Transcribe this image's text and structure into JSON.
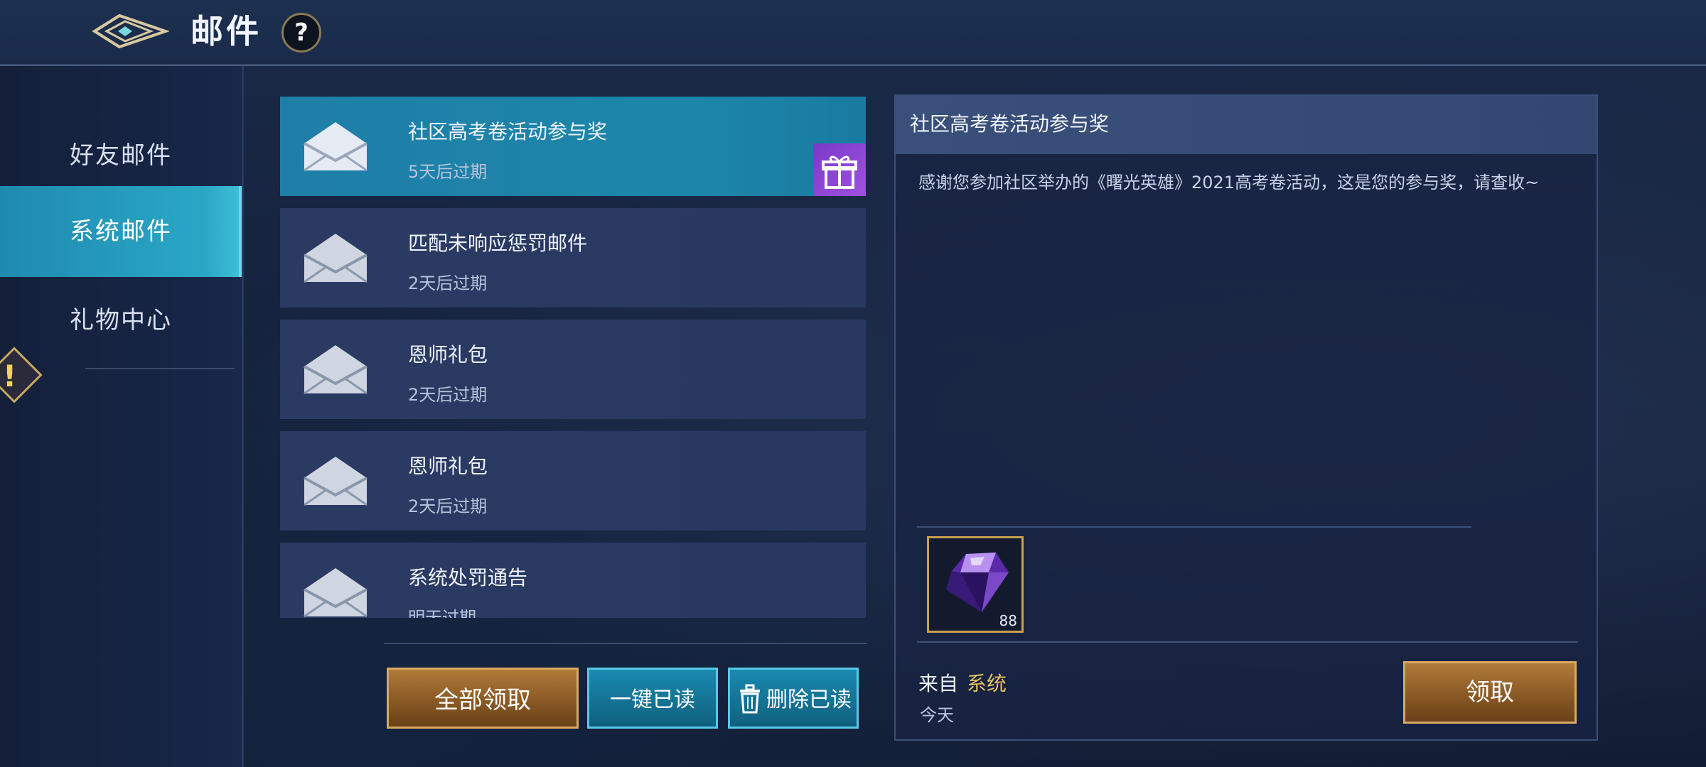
{
  "header": {
    "title": "邮件",
    "help_label": "?"
  },
  "sidebar": {
    "items": [
      {
        "label": "好友邮件",
        "active": false
      },
      {
        "label": "系统邮件",
        "active": true
      },
      {
        "label": "礼物中心",
        "active": false
      }
    ],
    "warning_label": "!"
  },
  "mail_list": {
    "items": [
      {
        "title": "社区高考卷活动参与奖",
        "expiry": "5天后过期",
        "active": true,
        "has_gift": true
      },
      {
        "title": "匹配未响应惩罚邮件",
        "expiry": "2天后过期",
        "active": false,
        "has_gift": false
      },
      {
        "title": "恩师礼包",
        "expiry": "2天后过期",
        "active": false,
        "has_gift": false
      },
      {
        "title": "恩师礼包",
        "expiry": "2天后过期",
        "active": false,
        "has_gift": false
      },
      {
        "title": "系统处罚通告",
        "expiry": "明天过期",
        "active": false,
        "has_gift": false
      }
    ]
  },
  "actions": {
    "claim_all": "全部领取",
    "mark_all_read": "一键已读",
    "delete_read": "删除已读"
  },
  "detail": {
    "title": "社区高考卷活动参与奖",
    "body": "感谢您参加社区举办的《曙光英雄》2021高考卷活动，这是您的参与奖，请查收~",
    "attachment": {
      "icon": "purple-gem-icon",
      "quantity": "88"
    },
    "from_label": "来自",
    "from_value": "系统",
    "date": "今天",
    "claim_button": "领取"
  },
  "colors": {
    "accent_cyan": "#2aa7c6",
    "gold_text": "#e8c060",
    "gold_border": "#d8a862"
  }
}
